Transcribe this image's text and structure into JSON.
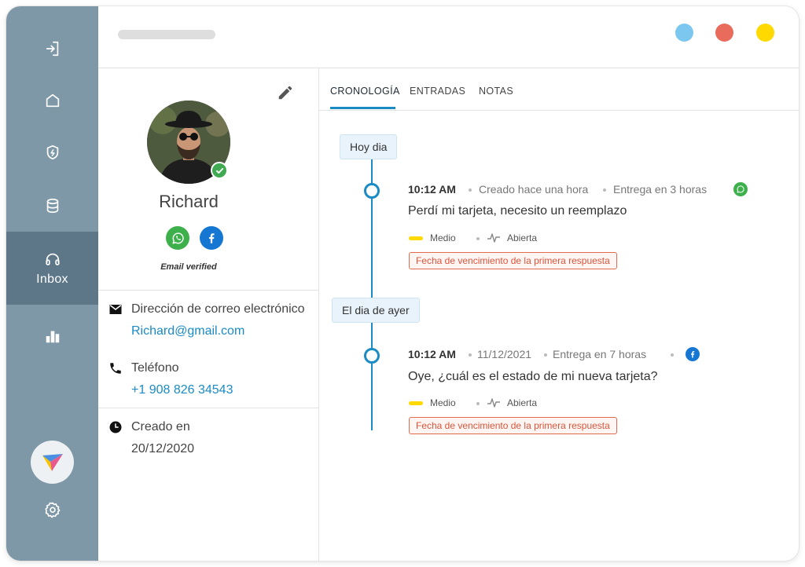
{
  "window_controls": {
    "colors": [
      "#7cc7ef",
      "#e96b5c",
      "#ffd900"
    ]
  },
  "sidebar": {
    "items": [
      {
        "icon": "logout-icon"
      },
      {
        "icon": "home-icon"
      },
      {
        "icon": "shield-bolt-icon"
      },
      {
        "icon": "database-icon"
      },
      {
        "icon": "headphones-icon",
        "label": "Inbox",
        "active": true
      },
      {
        "icon": "bar-chart-icon"
      }
    ],
    "bottom": [
      {
        "icon": "app-logo-icon"
      },
      {
        "icon": "gear-icon"
      }
    ]
  },
  "contact": {
    "name": "Richard",
    "email_verified": "Email verified",
    "channels": [
      "whatsapp-icon",
      "facebook-icon"
    ],
    "email_label": "Dirección de correo electrónico",
    "email_value": "Richard@gmail.com",
    "phone_label": "Teléfono",
    "phone_value": "+1 908 826 34543",
    "created_label": "Creado en",
    "created_value": "20/12/2020"
  },
  "tabs": [
    {
      "label": "CRONOLOGÍA",
      "active": true
    },
    {
      "label": "ENTRADAS"
    },
    {
      "label": "NOTAS"
    }
  ],
  "timeline": {
    "groups": [
      {
        "day": "Hoy dia",
        "event": {
          "time": "10:12 AM",
          "meta1": "Creado hace una hora",
          "meta2": "Entrega en 3 horas",
          "channel": "whatsapp-icon",
          "title": "Perdí mi tarjeta, necesito un reemplazo",
          "priority": "Medio",
          "status": "Abierta",
          "sla": "Fecha de vencimiento de la primera respuesta"
        }
      },
      {
        "day": "El dia de ayer",
        "event": {
          "time": "10:12 AM",
          "meta1": "11/12/2021",
          "meta2": "Entrega en 7 horas",
          "channel": "facebook-icon",
          "title": "Oye, ¿cuál es el estado de mi nueva tarjeta?",
          "priority": "Medio",
          "status": "Abierta",
          "sla": "Fecha de vencimiento de la primera respuesta"
        }
      }
    ]
  },
  "colors": {
    "sidebar": "#7f98a7",
    "sidebar_active": "#5d7688",
    "accent": "#1a8bc4",
    "priority_medium": "#ffd900",
    "sla_red": "#d9553a",
    "whatsapp": "#3db04b",
    "facebook": "#1677d3"
  }
}
